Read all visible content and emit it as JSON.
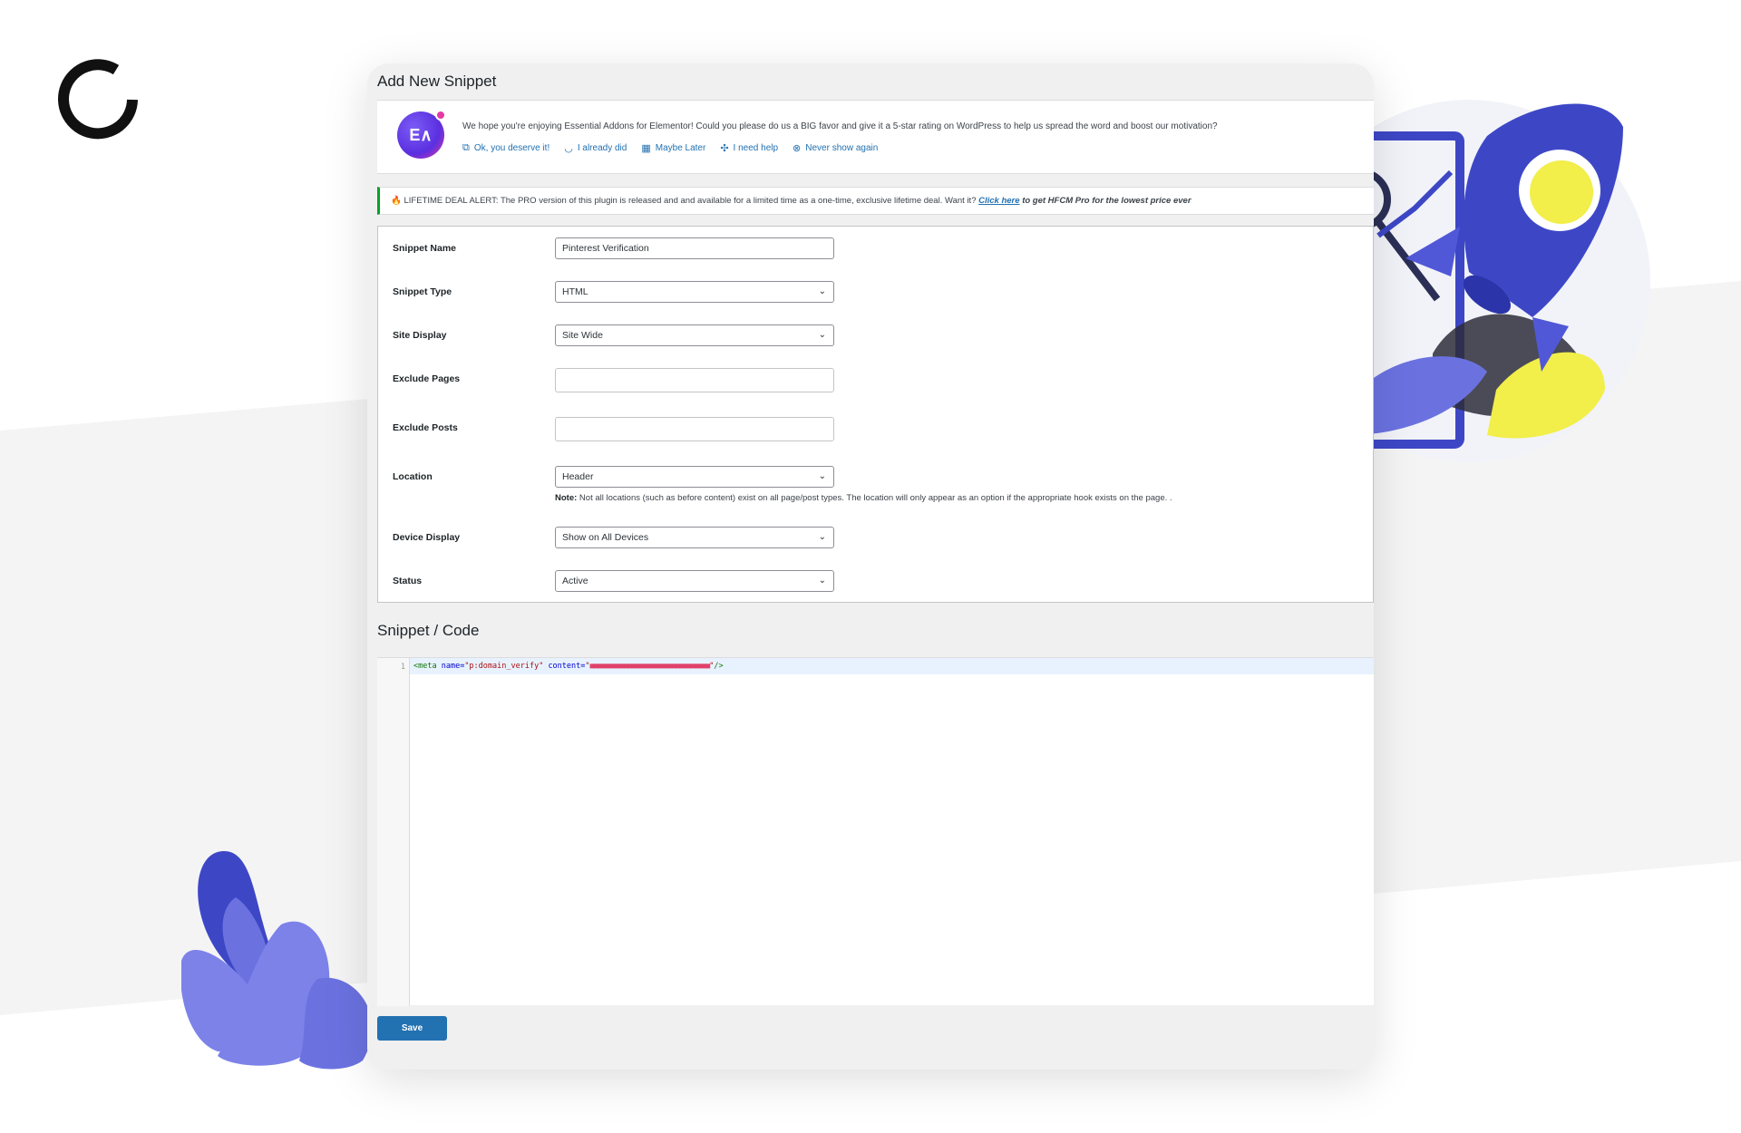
{
  "page": {
    "title": "Add New Snippet"
  },
  "ea_notice": {
    "logo_text": "E∧",
    "message": "We hope you're enjoying Essential Addons for Elementor! Could you please do us a BIG favor and give it a 5-star rating on WordPress to help us spread the word and boost our motivation?",
    "links": [
      {
        "icon": "external-link-icon",
        "label": "Ok, you deserve it!"
      },
      {
        "icon": "smile-icon",
        "label": "I already did"
      },
      {
        "icon": "calendar-icon",
        "label": "Maybe Later"
      },
      {
        "icon": "help-icon",
        "label": "I need help"
      },
      {
        "icon": "close-circle-icon",
        "label": "Never show again"
      }
    ]
  },
  "deal_notice": {
    "icon": "fire-icon",
    "text": "LIFETIME DEAL ALERT: The PRO version of this plugin is released and and available for a limited time as a one-time, exclusive lifetime deal. Want it?",
    "link_label": "Click here",
    "tail": "to get HFCM Pro for the lowest price ever"
  },
  "form": {
    "snippet_name": {
      "label": "Snippet Name",
      "value": "Pinterest Verification"
    },
    "snippet_type": {
      "label": "Snippet Type",
      "value": "HTML"
    },
    "site_display": {
      "label": "Site Display",
      "value": "Site Wide"
    },
    "exclude_pages": {
      "label": "Exclude Pages",
      "value": ""
    },
    "exclude_posts": {
      "label": "Exclude Posts",
      "value": ""
    },
    "location": {
      "label": "Location",
      "value": "Header",
      "note_bold": "Note:",
      "note": "Not all locations (such as before content) exist on all page/post types. The location will only appear as an option if the appropriate hook exists on the page. ."
    },
    "device_display": {
      "label": "Device Display",
      "value": "Show on All Devices"
    },
    "status": {
      "label": "Status",
      "value": "Active"
    }
  },
  "code": {
    "title": "Snippet / Code",
    "line_number": "1",
    "tag_open": "<meta",
    "attr_name": "name=",
    "value_name": "\"p:domain_verify\"",
    "attr_content": "content=",
    "quote_open": "\"",
    "redacted": "■■■■■■■■■■■■■■■■■■■■■■■■■■■■■■■■",
    "quote_close": "\"",
    "tag_close": "/>"
  },
  "actions": {
    "save_label": "Save"
  },
  "colors": {
    "accent": "#2271b1",
    "success_border": "#00a32a",
    "brand_purple": "#5b4fd8"
  }
}
